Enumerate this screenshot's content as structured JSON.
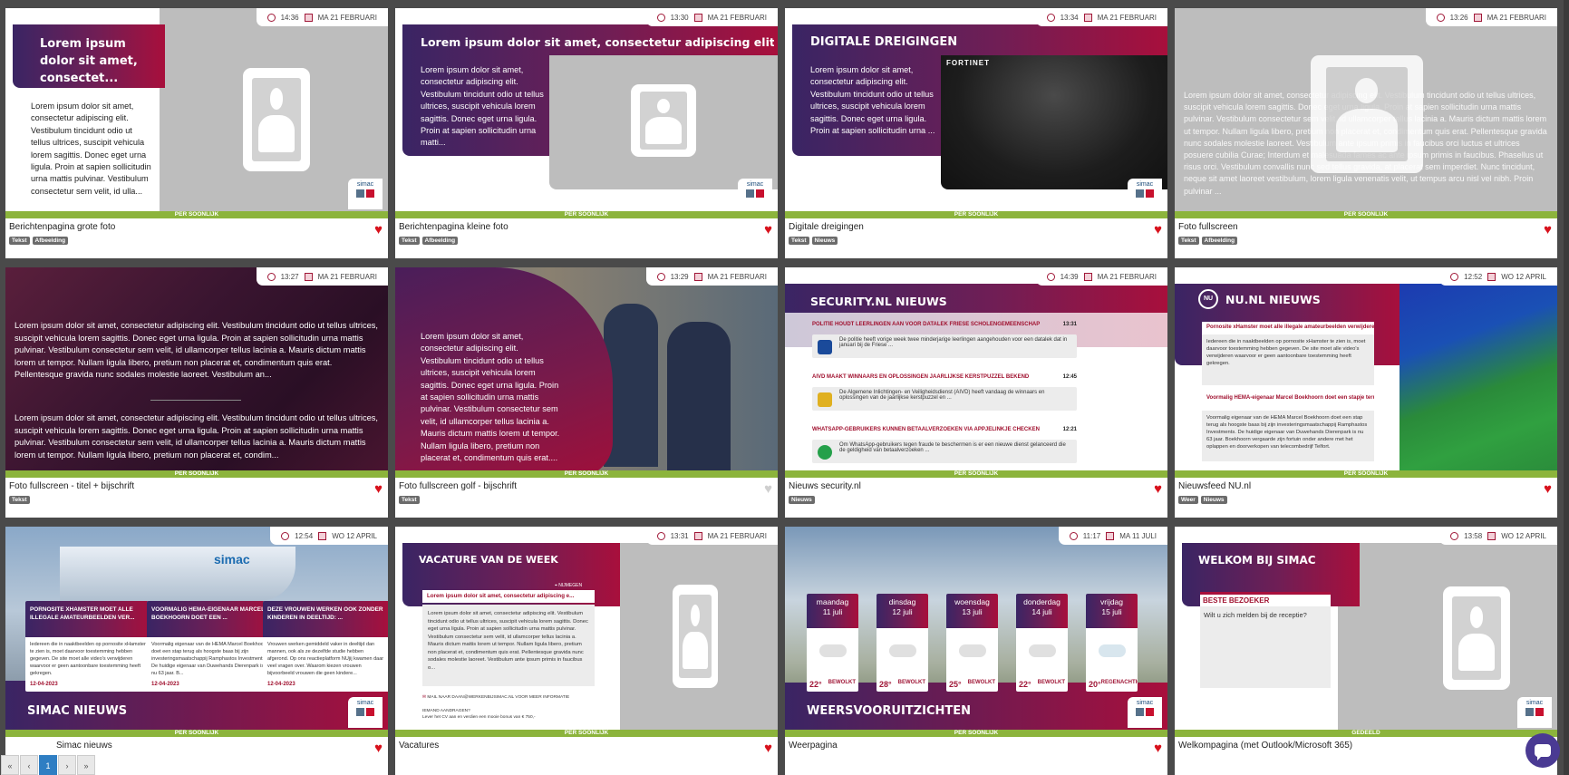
{
  "cards": [
    {
      "name": "Berichtenpagina grote foto",
      "tags": [
        "Tekst",
        "Afbeelding"
      ],
      "fav": true,
      "time": "14:36",
      "date": "MA 21 FEBRUARI",
      "strip": "PER SOONLIJK",
      "title": "Lorem ipsum dolor sit amet, consectet...",
      "body": "Lorem ipsum dolor sit amet, consectetur adipiscing elit. Vestibulum tincidunt odio ut tellus ultrices, suscipit vehicula lorem sagittis. Donec eget urna ligula. Proin at sapien sollicitudin urna mattis pulvinar. Vestibulum consectetur sem velit, id ulla...",
      "logo": "simac"
    },
    {
      "name": "Berichtenpagina kleine foto",
      "tags": [
        "Tekst",
        "Afbeelding"
      ],
      "fav": true,
      "time": "13:30",
      "date": "MA 21 FEBRUARI",
      "strip": "PER SOONLIJK",
      "title": "Lorem ipsum dolor sit amet, consectetur adipiscing elit. Ves...",
      "body": "Lorem ipsum dolor sit amet, consectetur adipiscing elit. Vestibulum tincidunt odio ut tellus ultrices, suscipit vehicula lorem sagittis. Donec eget urna ligula. Proin at sapien sollicitudin urna matti...",
      "logo": "simac"
    },
    {
      "name": "Digitale dreigingen",
      "tags": [
        "Tekst",
        "Nieuws"
      ],
      "fav": true,
      "time": "13:34",
      "date": "MA 21 FEBRUARI",
      "strip": "PER SOONLIJK",
      "title": "DIGITALE DREIGINGEN",
      "body": "Lorem ipsum dolor sit amet, consectetur adipiscing elit. Vestibulum tincidunt odio ut tellus ultrices, suscipit vehicula lorem sagittis. Donec eget urna ligula. Proin at sapien sollicitudin urna ...",
      "video_brand": "FORTINET",
      "logo": "simac"
    },
    {
      "name": "Foto fullscreen",
      "tags": [
        "Tekst",
        "Afbeelding"
      ],
      "fav": true,
      "time": "13:26",
      "date": "MA 21 FEBRUARI",
      "strip": "PER SOONLIJK",
      "body": "Lorem ipsum dolor sit amet, consectetur adipiscing elit. Vestibulum tincidunt odio ut tellus ultrices, suscipit vehicula lorem sagittis. Donec eget urna ligula. Proin at sapien sollicitudin urna mattis pulvinar. Vestibulum consectetur sem velit, id ullamcorper tellus lacinia a. Mauris dictum mattis lorem ut tempor. Nullam ligula libero, pretium non placerat et, condimentum quis erat. Pellentesque gravida nunc sodales molestie laoreet. Vestibulum ante ipsum primis in faucibus orci luctus et ultrices posuere cubilia Curae; Interdum et malesuada fames ac ante ipsum primis in faucibus. Phasellus ut risus orci. Vestibulum convallis nunc sed tellus gravida, at placerat sem imperdiet. Nunc tincidunt, neque sit amet laoreet vestibulum, lorem ligula venenatis velit, ut tempus arcu nisl vel nibh. Proin pulvinar ..."
    },
    {
      "name": "Foto fullscreen - titel + bijschrift",
      "tags": [
        "Tekst"
      ],
      "fav": true,
      "time": "13:27",
      "date": "MA 21 FEBRUARI",
      "strip": "PER SOONLIJK",
      "body": "Lorem ipsum dolor sit amet, consectetur adipiscing elit. Vestibulum tincidunt odio ut tellus ultrices, suscipit vehicula lorem sagittis. Donec eget urna ligula. Proin at sapien sollicitudin urna mattis pulvinar. Vestibulum consectetur sem velit, id ullamcorper tellus lacinia a. Mauris dictum mattis lorem ut tempor. Nullam ligula libero, pretium non placerat et, condimentum quis erat. Pellentesque gravida nunc sodales molestie laoreet. Vestibulum an...",
      "body2": "Lorem ipsum dolor sit amet, consectetur adipiscing elit. Vestibulum tincidunt odio ut tellus ultrices, suscipit vehicula lorem sagittis. Donec eget urna ligula. Proin at sapien sollicitudin urna mattis pulvinar. Vestibulum consectetur sem velit, id ullamcorper tellus lacinia a. Mauris dictum mattis lorem ut tempor. Nullam ligula libero, pretium non placerat et, condim..."
    },
    {
      "name": "Foto fullscreen golf - bijschrift",
      "tags": [
        "Tekst"
      ],
      "fav": false,
      "time": "13:29",
      "date": "MA 21 FEBRUARI",
      "strip": "PER SOONLIJK",
      "body": "Lorem ipsum dolor sit amet, consectetur adipiscing elit. Vestibulum tincidunt odio ut tellus ultrices, suscipit vehicula lorem sagittis. Donec eget urna ligula. Proin at sapien sollicitudin urna mattis pulvinar. Vestibulum consectetur sem velit, id ullamcorper tellus lacinia a. Mauris dictum mattis lorem ut tempor. Nullam ligula libero, pretium non placerat et, condimentum quis erat...."
    },
    {
      "name": "Nieuws security.nl",
      "tags": [
        "Nieuws"
      ],
      "fav": true,
      "time": "14:39",
      "date": "MA 21 FEBRUARI",
      "strip": "PER SOONLIJK",
      "title": "SECURITY.NL NIEUWS",
      "items": [
        {
          "head": "POLITIE HOUDT LEERLINGEN AAN VOOR DATALEK FRIESE SCHOLENGEMEENSCHAP",
          "time": "13:31",
          "text": "De politie heeft vorige week twee minderjarige leerlingen aangehouden voor een datalek dat in januari bij de Friese ..."
        },
        {
          "head": "AIVD MAAKT WINNAARS EN OPLOSSINGEN JAARLIJKSE KERSTPUZZEL BEKEND",
          "time": "12:45",
          "text": "De Algemene Inlichtingen- en Veiligheidsdienst (AIVD) heeft vandaag de winnaars en oplossingen van de jaarlijkse kerstpuzzel en ..."
        },
        {
          "head": "WHATSAPP-GEBRUIKERS KUNNEN BETAALVERZOEKEN VIA APPJELINKJE CHECKEN",
          "time": "12:21",
          "text": "Om WhatsApp-gebruikers tegen fraude te beschermen is er een nieuwe dienst gelanceerd die de geldigheid van betaalverzoeken ..."
        }
      ]
    },
    {
      "name": "Nieuwsfeed NU.nl",
      "tags": [
        "Weer",
        "Nieuws"
      ],
      "fav": true,
      "time": "12:52",
      "date": "WO 12 APRIL",
      "strip": "PER SOONLIJK",
      "title": "NU.NL NIEUWS",
      "badge": "NU",
      "items": [
        {
          "head": "Pornosite xHamster moet alle illegale amateurbeelden verwijderen",
          "text": "Iedereen die in naaktbeelden op pornosite xHamster te zien is, moet daarvoor toestemming hebben gegeven. De site moet alle video's verwijderen waarvoor er geen aantoonbare toestemming heeft gekregen."
        },
        {
          "head": "Voormalig HEMA-eigenaar Marcel Boekhoorn doet een stapje terug",
          "text": "Voormalig eigenaar van de HEMA Marcel Boekhoorn doet een stap terug als hoogste baas bij zijn investeringsmaatschappij Ramphastos Investments. De huidige eigenaar van Duwehands Dierenpark is nu 63 jaar. Boekhoorn vergaarde zijn fortuin onder andere met het oplappen en doorverkopen van telecombedrijf Telfort."
        }
      ]
    },
    {
      "name": "Simac nieuws",
      "tags": [],
      "fav": true,
      "time": "12:54",
      "date": "WO 12 APRIL",
      "strip": "PER SOONLIJK",
      "title": "SIMAC NIEUWS",
      "building": "simac",
      "items": [
        {
          "head": "PORNOSITE XHAMSTER MOET ALLE ILLEGALE AMATEURBEELDEN VER...",
          "text": "Iedereen die in naaktbeelden op pornosite xHamster te zien is, moet daarvoor toestemming hebben gegeven. De site moet alle video's verwijderen waarvoor er geen aantoonbare toestemming heeft gekregen.",
          "date": "12-04-2023"
        },
        {
          "head": "VOORMALIG HEMA-EIGENAAR MARCEL BOEKHOORN DOET EEN ...",
          "text": "Voormalig eigenaar van de HEMA Marcel Boekhoorn doet een stap terug als hoogste baas bij zijn investeringsmaatschappij Ramphastos Investments. De huidige eigenaar van Duwehands Dierenpark is nu 63 jaar. B...",
          "date": "12-04-2023"
        },
        {
          "head": "DEZE VROUWEN WERKEN OOK ZONDER KINDEREN IN DEELTIJD: ...",
          "text": "Vrouwen werken gemiddeld vaker in deeltijd dan mannen, ook als ze dezelfde studie hebben afgerond. Op ons reactieplatform NUjij kwamen daar veel vragen over. Waarom kiezen vrouwen bijvoorbeeld vrouwen die geen kindere...",
          "date": "12-04-2023"
        }
      ]
    },
    {
      "name": "Vacatures",
      "tags": [],
      "fav": true,
      "time": "13:31",
      "date": "MA 21 FEBRUARI",
      "strip": "PER SOONLIJK",
      "title": "VACATURE VAN DE WEEK",
      "location": "NIJMEGEN",
      "sub": "Lorem ipsum dolor sit amet, consectetur adipiscing e...",
      "body": "Lorem ipsum dolor sit amet, consectetur adipiscing elit. Vestibulum tincidunt odio ut tellus ultrices, suscipit vehicula lorem sagittis. Donec eget urna ligula. Proin at sapien sollicitudin urna mattis pulvinar. Vestibulum consectetur sem velit, id ullamcorper tellus lacinia a. Mauris dictum mattis lorem ut tempor. Nullam ligula libero, pretium non placerat et, condimentum quis erat. Pellentesque gravida nunc sodales molestie laoreet. Vestibulum ante ipsum primis in faucibus o...",
      "mail": "MAIL NAAR DAAN@WERKENBIJSIMAC.NL VOOR MEER INFORMATIE",
      "ref1": "IEMAND AANDRAGEN?",
      "ref2": "Lever het CV aan en verdien een mooie bonus van € 750,-"
    },
    {
      "name": "Weerpagina",
      "tags": [],
      "fav": true,
      "time": "11:17",
      "date": "MA 11 JULI",
      "strip": "PER SOONLIJK",
      "title": "WEERSVOORUITZICHTEN",
      "days": [
        {
          "day": "maandag",
          "date": "11 juli",
          "temp": "22°",
          "cond": "BEWOLKT"
        },
        {
          "day": "dinsdag",
          "date": "12 juli",
          "temp": "28°",
          "cond": "BEWOLKT"
        },
        {
          "day": "woensdag",
          "date": "13 juli",
          "temp": "25°",
          "cond": "BEWOLKT"
        },
        {
          "day": "donderdag",
          "date": "14 juli",
          "temp": "22°",
          "cond": "BEWOLKT"
        },
        {
          "day": "vrijdag",
          "date": "15 juli",
          "temp": "20°",
          "cond": "REGENACHTIG"
        }
      ]
    },
    {
      "name": "Welkompagina (met Outlook/Microsoft 365)",
      "tags": [],
      "fav": false,
      "time": "13:58",
      "date": "WO 12 APRIL",
      "strip": "GEDEELD",
      "title": "WELKOM BIJ SIMAC",
      "sub": "BESTE BEZOEKER",
      "body": "Wilt u zich melden bij de receptie?"
    }
  ],
  "pager": {
    "first": "«",
    "prev": "‹",
    "page": "1",
    "next": "›",
    "last": "»"
  },
  "colors": {
    "accent": "#a80f3c",
    "strip_green": "#8cb43c",
    "heart": "#d8121d"
  }
}
